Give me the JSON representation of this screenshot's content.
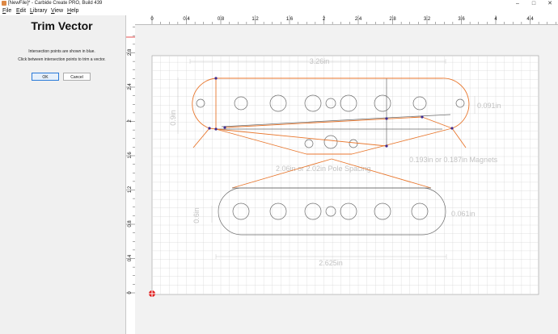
{
  "window": {
    "title": "[NewFile]* - Carbide Create PRO, Build 439"
  },
  "menu": [
    {
      "label": "File",
      "hotkey": "F",
      "rest": "ile"
    },
    {
      "label": "Edit",
      "hotkey": "E",
      "rest": "dit"
    },
    {
      "label": "Library",
      "hotkey": "L",
      "rest": "ibrary"
    },
    {
      "label": "View",
      "hotkey": "V",
      "rest": "iew"
    },
    {
      "label": "Help",
      "hotkey": "H",
      "rest": "elp"
    }
  ],
  "panel": {
    "title": "Trim Vector",
    "instruction1": "Intersection points are shown in blue.",
    "instruction2": "Click between intersection points to trim a vector.",
    "ok_label": "OK",
    "cancel_label": "Cancel"
  },
  "ruler_top": {
    "labels": [
      "0",
      "0.4",
      "0.8",
      "1.2",
      "1.6",
      "2",
      "2.4",
      "2.8",
      "3.2",
      "3.6",
      "4",
      "4.4"
    ]
  },
  "ruler_left": {
    "labels": [
      "2.8",
      "2.4",
      "2",
      "1.6",
      "1.2",
      "0.8",
      "0.4",
      "0"
    ]
  },
  "dimensions": {
    "top_width": "3.26in",
    "right_dia": "0.091in",
    "left_height": "0.9in",
    "magnets": "0.193in or 0.187in Magnets",
    "pole_spacing": "2.06in or 2.02in Pole Spacing",
    "lower_right": "0.061in",
    "lower_left": "0.6in",
    "bottom_width": "2.625in"
  },
  "colors": {
    "orange": "#e8762c",
    "intersection": "#3e2a8f",
    "origin": "#e02020",
    "grid": "#d6d6d6",
    "plate": "#ffffff"
  }
}
